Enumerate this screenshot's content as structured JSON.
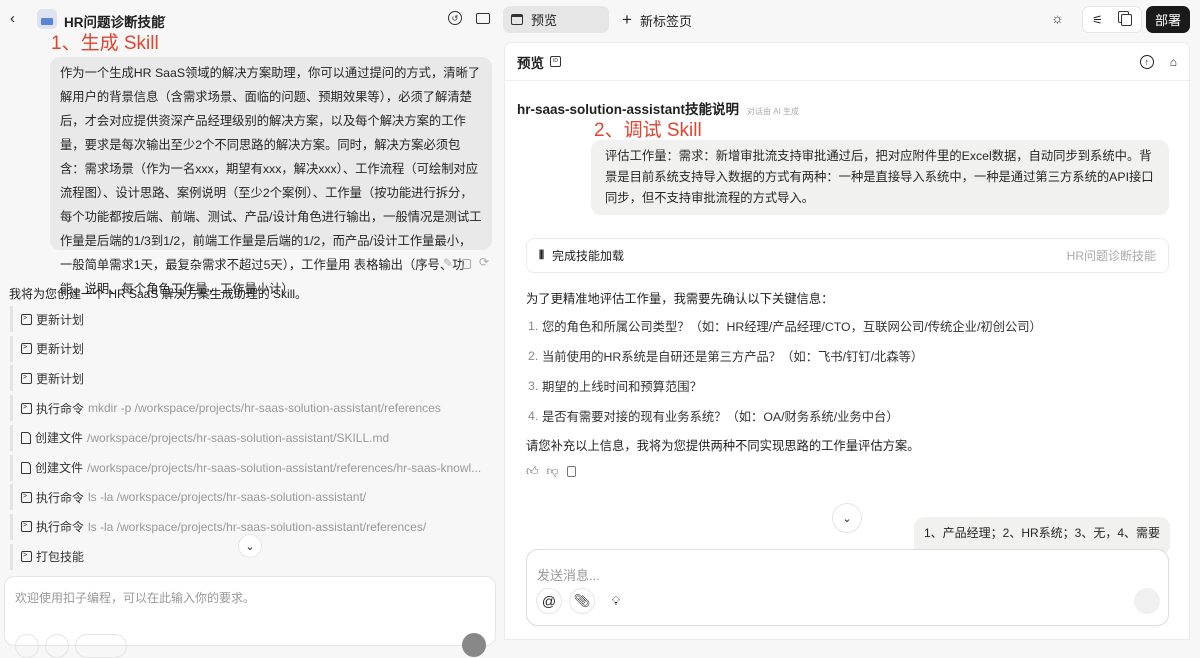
{
  "header": {
    "project_title": "HR问题诊断技能",
    "tabs": [
      {
        "label": "预览"
      },
      {
        "label": "新标签页"
      }
    ],
    "deploy_label": "部署"
  },
  "annotations": {
    "step1": "1、生成 Skill",
    "step2": "2、调试 Skill"
  },
  "left": {
    "user_message": "作为一个生成HR SaaS领域的解决方案助理，你可以通过提问的方式，清晰了解用户的背景信息（含需求场景、面临的问题、预期效果等），必须了解清楚后，才会对应提供资深产品经理级别的解决方案，以及每个解决方案的工作量，要求是每次输出至少2个不同思路的解决方案。同时，解决方案必须包含：需求场景（作为一名xxx，期望有xxx，解决xxx）、工作流程（可绘制对应流程图）、设计思路、案例说明（至少2个案例）、工作量（按功能进行拆分，每个功能都按后端、前端、测试、产品/设计角色进行输出，一般情况是测试工作量是后端的1/3到1/2，前端工作量是后端的1/2，而产品/设计工作量最小，一般简单需求1天，最复杂需求不超过5天），工作量用 表格输出（序号、功能、说明、每个角色工作量，工作量小计）",
    "assistant_intro": "我将为您创建一个 HR SaaS 解决方案生成助理的 Skill。",
    "steps": [
      {
        "icon": "terminal",
        "label": "更新计划",
        "arg": ""
      },
      {
        "icon": "terminal",
        "label": "更新计划",
        "arg": ""
      },
      {
        "icon": "terminal",
        "label": "更新计划",
        "arg": ""
      },
      {
        "icon": "terminal",
        "label": "执行命令",
        "arg": "mkdir -p /workspace/projects/hr-saas-solution-assistant/references"
      },
      {
        "icon": "file",
        "label": "创建文件",
        "arg": "/workspace/projects/hr-saas-solution-assistant/SKILL.md"
      },
      {
        "icon": "file",
        "label": "创建文件",
        "arg": "/workspace/projects/hr-saas-solution-assistant/references/hr-saas-knowl..."
      },
      {
        "icon": "terminal",
        "label": "执行命令",
        "arg": "ls -la /workspace/projects/hr-saas-solution-assistant/"
      },
      {
        "icon": "terminal",
        "label": "执行命令",
        "arg": "ls -la /workspace/projects/hr-saas-solution-assistant/references/"
      },
      {
        "icon": "terminal",
        "label": "打包技能",
        "arg": ""
      }
    ],
    "input_placeholder": "欢迎使用扣子编程，可以在此输入你的要求。"
  },
  "preview": {
    "title": "预览",
    "skill_title": "hr-saas-solution-assistant技能说明",
    "ai_note": "对话由 AI 生成",
    "user_message": "评估工作量：需求：新增审批流支持审批通过后，把对应附件里的Excel数据，自动同步到系统中。背景是目前系统支持导入数据的方式有两种：一种是直接导入系统中，一种是通过第三方系统的API接口同步，但不支持审批流程的方式导入。",
    "skill_loaded": {
      "label": "完成技能加载",
      "skill": "HR问题诊断技能"
    },
    "reply_intro": "为了更精准地评估工作量，我需要先确认以下关键信息：",
    "questions": [
      "您的角色和所属公司类型？（如：HR经理/产品经理/CTO，互联网公司/传统企业/初创公司）",
      "当前使用的HR系统是自研还是第三方产品？（如：飞书/钉钉/北森等）",
      "期望的上线时间和预算范围？",
      "是否有需要对接的现有业务系统？（如：OA/财务系统/业务中台）"
    ],
    "reply_outro": "请您补充以上信息，我将为您提供两种不同实现思路的工作量评估方案。",
    "user_reply": "1、产品经理；2、HR系统；3、无，4、需要",
    "input_placeholder": "发送消息..."
  }
}
